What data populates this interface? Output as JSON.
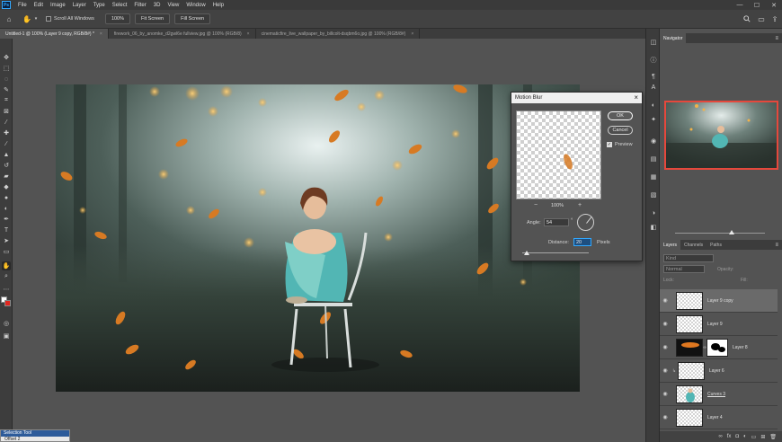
{
  "app": {
    "logo": "Ps"
  },
  "menu": [
    "File",
    "Edit",
    "Image",
    "Layer",
    "Type",
    "Select",
    "Filter",
    "3D",
    "View",
    "Window",
    "Help"
  ],
  "window_controls": {
    "minimize": "—",
    "maximize": "☐",
    "close": "✕"
  },
  "options": {
    "scroll_all_windows": "Scroll All Windows",
    "zoom": "100%",
    "fit_screen": "Fit Screen",
    "fill_screen": "Fill Screen"
  },
  "tabs": [
    {
      "label": "Untitled-1 @ 100% (Layer 9 copy, RGB/8#) *"
    },
    {
      "label": "firework_06_by_anomke_d2gwl6e fullview.jpg @ 100% (RGB/8)"
    },
    {
      "label": "cinematicfire_live_wallpaper_by_billcolt-dsqbm6o.jpg @ 100% (RGB/8#)"
    }
  ],
  "dialog": {
    "title": "Motion Blur",
    "ok": "OK",
    "cancel": "Cancel",
    "preview_label": "Preview",
    "zoom_level": "100%",
    "zoom_out": "−",
    "zoom_in": "+",
    "angle_label": "Angle:",
    "angle_value": "54",
    "angle_unit": "°",
    "distance_label": "Distance:",
    "distance_value": "20",
    "distance_unit": "Pixels"
  },
  "navigator": {
    "title": "Navigator"
  },
  "layers_panel": {
    "tabs": [
      "Layers",
      "Channels",
      "Paths"
    ],
    "search_placeholder": "Kind",
    "blend_mode": "Normal",
    "opacity_label": "Opacity:",
    "lock_label": "Lock:",
    "fill_label": "Fill:",
    "layers": [
      {
        "name": "Layer 9 copy",
        "selected": true
      },
      {
        "name": "Layer 9",
        "selected": false
      },
      {
        "name": "Layer 8",
        "selected": false
      },
      {
        "name": "Layer 6",
        "selected": false
      },
      {
        "name": "Curves 3",
        "selected": false
      },
      {
        "name": "Layer 4",
        "selected": false
      }
    ]
  },
  "tooltip_panel": {
    "title": "Selection Tool",
    "item": "Offset 2"
  },
  "colors": {
    "accent": "#31a8ff",
    "navigator_frame": "#e5483c"
  }
}
